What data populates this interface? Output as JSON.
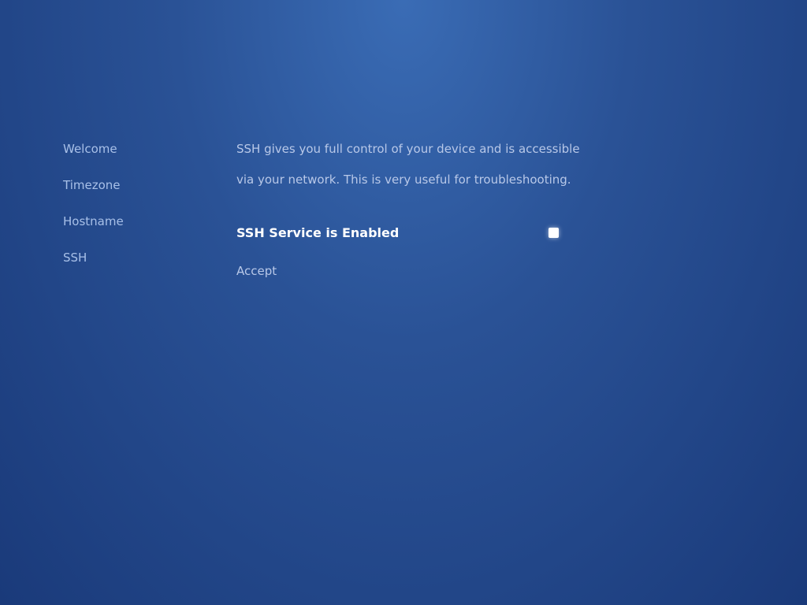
{
  "sidebar": {
    "items": [
      {
        "label": "Welcome"
      },
      {
        "label": "Timezone"
      },
      {
        "label": "Hostname"
      },
      {
        "label": "SSH"
      }
    ]
  },
  "content": {
    "description_line1": "SSH gives you full control of your device and is accessible",
    "description_line2": "via your network. This is very useful for troubleshooting.",
    "ssh_toggle_label": "SSH Service is Enabled",
    "accept_label": "Accept"
  }
}
